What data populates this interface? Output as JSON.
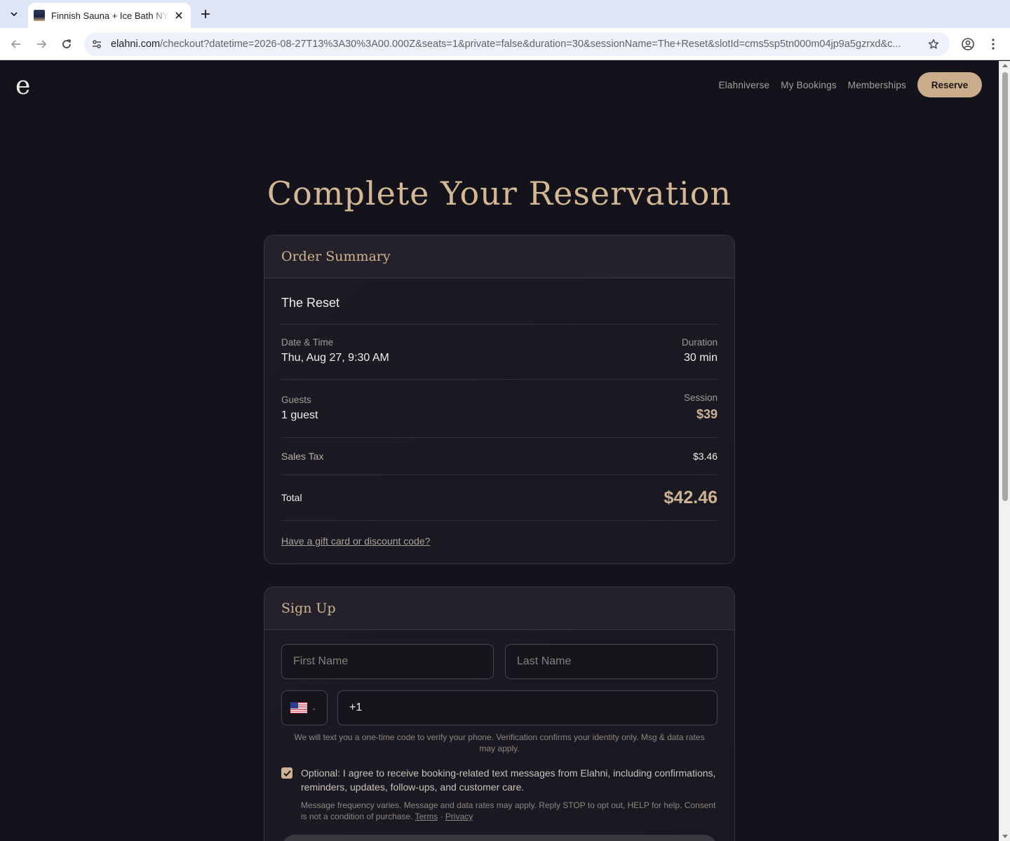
{
  "browser": {
    "tab_title": "Finnish Sauna + Ice Bath NYC",
    "url_host": "elahni.com",
    "url_path": "/checkout?datetime=2026-08-27T13%3A30%3A00.000Z&seats=1&private=false&duration=30&sessionName=The+Reset&slotId=cms5sp5tn000m04jp9a5gzrxd&c..."
  },
  "site": {
    "logo": "e",
    "nav": {
      "elahniverse": "Elahniverse",
      "my_bookings": "My Bookings",
      "memberships": "Memberships",
      "reserve": "Reserve"
    },
    "accent_color": "#c9ad8a"
  },
  "page": {
    "title": "Complete Your Reservation"
  },
  "order_summary": {
    "heading": "Order Summary",
    "session_name": "The Reset",
    "date_label": "Date & Time",
    "date_value": "Thu, Aug 27, 9:30 AM",
    "duration_label": "Duration",
    "duration_value": "30 min",
    "guests_label": "Guests",
    "guests_value": "1 guest",
    "session_label": "Session",
    "session_price": "$39",
    "tax_label": "Sales Tax",
    "tax_value": "$3.46",
    "total_label": "Total",
    "total_value": "$42.46",
    "gift_link": "Have a gift card or discount code?"
  },
  "signup": {
    "heading": "Sign Up",
    "first_name_placeholder": "First Name",
    "last_name_placeholder": "Last Name",
    "country_flag": "us-flag",
    "phone_value": "+1",
    "helper": "We will text you a one-time code to verify your phone. Verification confirms your identity only. Msg & data rates may apply.",
    "consent_checked": true,
    "consent_text": "Optional: I agree to receive booking-related text messages from Elahni, including confirmations, reminders, updates, follow-ups, and customer care.",
    "fine_print": "Message frequency varies. Message and data rates may apply. Reply STOP to opt out, HELP for help. Consent is not a condition of purchase.",
    "terms": "Terms",
    "separator": "·",
    "privacy": "Privacy"
  }
}
